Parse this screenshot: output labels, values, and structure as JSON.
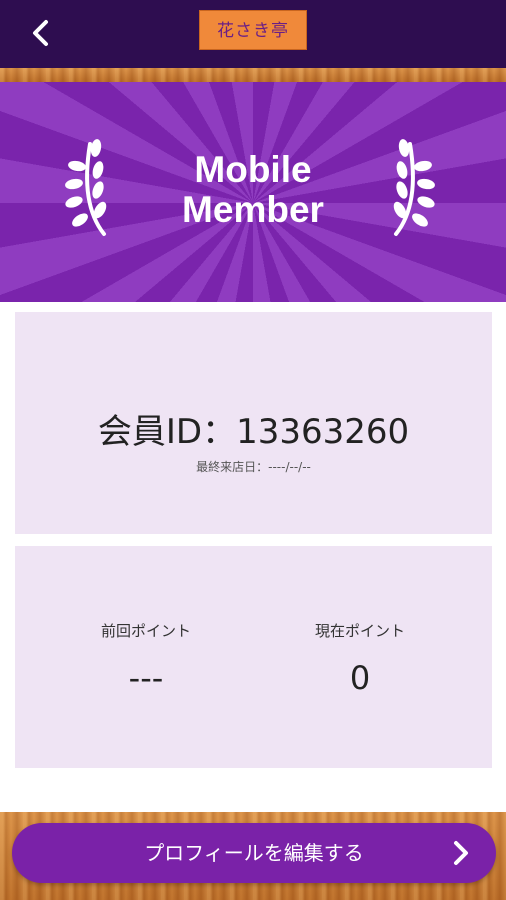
{
  "header": {
    "shop_name": "花さき亭"
  },
  "banner": {
    "title_line1": "Mobile",
    "title_line2": "Member"
  },
  "member_card": {
    "member_id": "会員ID：13363260",
    "last_visit": "最終来店日：----/--/--"
  },
  "points": {
    "previous_label": "前回ポイント",
    "previous_value": "---",
    "current_label": "現在ポイント",
    "current_value": "0"
  },
  "footer": {
    "edit_profile_label": "プロフィールを編集する"
  },
  "colors": {
    "header_bg": "#2e0d50",
    "accent_purple": "#7a22a8",
    "shop_label_bg": "#f0893a",
    "panel_bg": "#efe4f4"
  },
  "icons": {
    "back": "chevron-left-icon",
    "laurel": "laurel-icon",
    "edit_arrow": "chevron-right-icon"
  }
}
